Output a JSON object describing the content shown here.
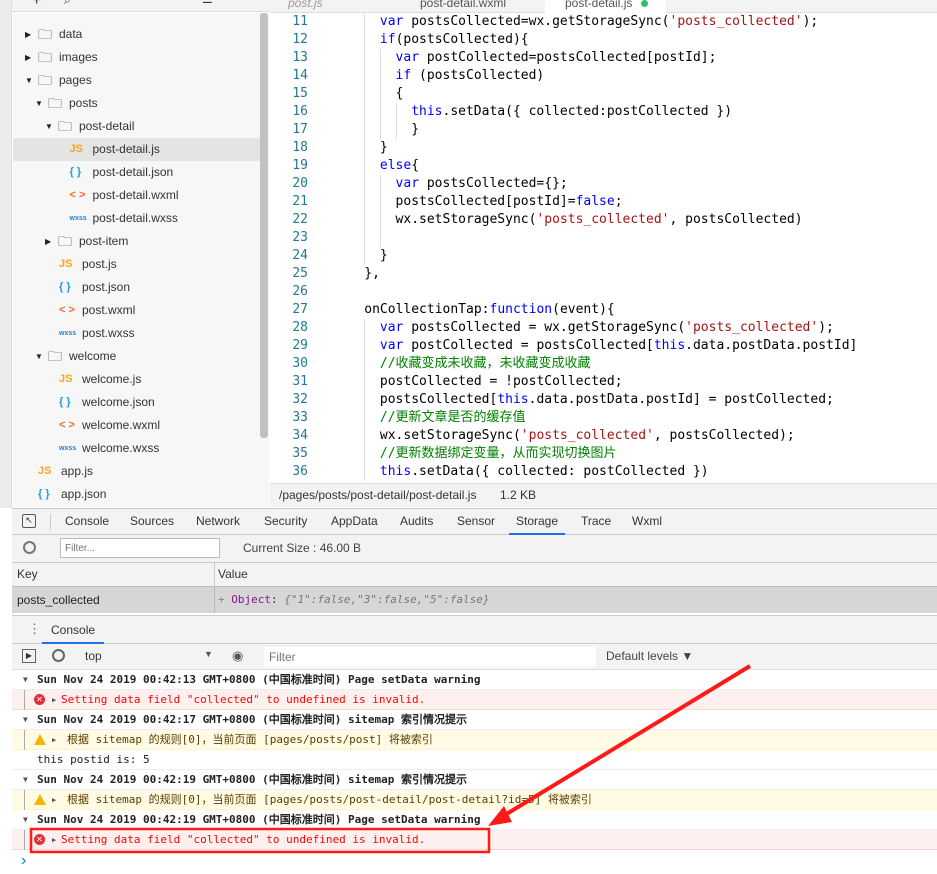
{
  "editor_tabs": [
    {
      "label": "post.js"
    },
    {
      "label": "post-detail.wxml"
    },
    {
      "label": "post-detail.js",
      "active": true,
      "modified": true
    }
  ],
  "tree": [
    {
      "kind": "folder",
      "label": "data",
      "depth": 0,
      "open": false
    },
    {
      "kind": "folder",
      "label": "images",
      "depth": 0,
      "open": false
    },
    {
      "kind": "folder",
      "label": "pages",
      "depth": 0,
      "open": true
    },
    {
      "kind": "folder",
      "label": "posts",
      "depth": 1,
      "open": true
    },
    {
      "kind": "folder",
      "label": "post-detail",
      "depth": 2,
      "open": true
    },
    {
      "kind": "js",
      "label": "post-detail.js",
      "depth": 3,
      "selected": true
    },
    {
      "kind": "json",
      "label": "post-detail.json",
      "depth": 3
    },
    {
      "kind": "wxml",
      "label": "post-detail.wxml",
      "depth": 3
    },
    {
      "kind": "wxss",
      "label": "post-detail.wxss",
      "depth": 3
    },
    {
      "kind": "folder",
      "label": "post-item",
      "depth": 2,
      "open": false
    },
    {
      "kind": "js",
      "label": "post.js",
      "depth": 2
    },
    {
      "kind": "json",
      "label": "post.json",
      "depth": 2
    },
    {
      "kind": "wxml",
      "label": "post.wxml",
      "depth": 2
    },
    {
      "kind": "wxss",
      "label": "post.wxss",
      "depth": 2
    },
    {
      "kind": "folder",
      "label": "welcome",
      "depth": 1,
      "open": true
    },
    {
      "kind": "js",
      "label": "welcome.js",
      "depth": 2
    },
    {
      "kind": "json",
      "label": "welcome.json",
      "depth": 2
    },
    {
      "kind": "wxml",
      "label": "welcome.wxml",
      "depth": 2
    },
    {
      "kind": "wxss",
      "label": "welcome.wxss",
      "depth": 2
    },
    {
      "kind": "js",
      "label": "app.js",
      "depth": 0
    },
    {
      "kind": "json",
      "label": "app.json",
      "depth": 0
    }
  ],
  "file_icons": {
    "js": {
      "glyph": "JS",
      "color": "#f5a623"
    },
    "json": {
      "glyph": "{ }",
      "color": "#1e9be6"
    },
    "wxml": {
      "glyph": "< >",
      "color": "#f06a2a"
    },
    "wxss": {
      "glyph": "wxss",
      "color": "#2a7ed0"
    }
  },
  "code": [
    {
      "n": "11",
      "indent": 6,
      "t": [
        [
          "kw",
          "var"
        ],
        [
          "pl",
          " postsCollected=wx.getStorageSync("
        ],
        [
          "str",
          "'posts_collected'"
        ],
        [
          "pl",
          ");"
        ]
      ]
    },
    {
      "n": "12",
      "indent": 6,
      "t": [
        [
          "kw",
          "if"
        ],
        [
          "pl",
          "(postsCollected){"
        ]
      ]
    },
    {
      "n": "13",
      "indent": 8,
      "t": [
        [
          "kw",
          "var"
        ],
        [
          "pl",
          " postCollected=postsCollected[postId];"
        ]
      ]
    },
    {
      "n": "14",
      "indent": 8,
      "t": [
        [
          "kw",
          "if"
        ],
        [
          "pl",
          " (postsCollected)"
        ]
      ]
    },
    {
      "n": "15",
      "indent": 8,
      "t": [
        [
          "pl",
          "{"
        ]
      ]
    },
    {
      "n": "16",
      "indent": 10,
      "t": [
        [
          "kw",
          "this"
        ],
        [
          "pl",
          ".setData({ collected:postCollected })"
        ]
      ]
    },
    {
      "n": "17",
      "indent": 10,
      "t": [
        [
          "pl",
          "}"
        ]
      ]
    },
    {
      "n": "18",
      "indent": 6,
      "t": [
        [
          "pl",
          "}"
        ]
      ]
    },
    {
      "n": "19",
      "indent": 6,
      "t": [
        [
          "kw",
          "else"
        ],
        [
          "pl",
          "{"
        ]
      ]
    },
    {
      "n": "20",
      "indent": 8,
      "t": [
        [
          "kw",
          "var"
        ],
        [
          "pl",
          " postsCollected={};"
        ]
      ]
    },
    {
      "n": "21",
      "indent": 8,
      "t": [
        [
          "pl",
          "postsCollected[postId]="
        ],
        [
          "kw",
          "false"
        ],
        [
          "pl",
          ";"
        ]
      ]
    },
    {
      "n": "22",
      "indent": 8,
      "t": [
        [
          "pl",
          "wx.setStorageSync("
        ],
        [
          "str",
          "'posts_collected'"
        ],
        [
          "pl",
          ", postsCollected)"
        ]
      ]
    },
    {
      "n": "23",
      "indent": 8,
      "t": []
    },
    {
      "n": "24",
      "indent": 6,
      "t": [
        [
          "pl",
          "}"
        ]
      ]
    },
    {
      "n": "25",
      "indent": 4,
      "t": [
        [
          "pl",
          "},"
        ]
      ]
    },
    {
      "n": "26",
      "indent": 4,
      "t": []
    },
    {
      "n": "27",
      "indent": 4,
      "t": [
        [
          "pl",
          "onCollectionTap:"
        ],
        [
          "kw",
          "function"
        ],
        [
          "pl",
          "(event){"
        ]
      ]
    },
    {
      "n": "28",
      "indent": 6,
      "t": [
        [
          "kw",
          "var"
        ],
        [
          "pl",
          " postsCollected = wx.getStorageSync("
        ],
        [
          "str",
          "'posts_collected'"
        ],
        [
          "pl",
          ");"
        ]
      ]
    },
    {
      "n": "29",
      "indent": 6,
      "t": [
        [
          "kw",
          "var"
        ],
        [
          "pl",
          " postCollected = postsCollected["
        ],
        [
          "kw",
          "this"
        ],
        [
          "pl",
          ".data.postData.postId]"
        ]
      ]
    },
    {
      "n": "30",
      "indent": 6,
      "t": [
        [
          "cm",
          "//收藏变成未收藏，未收藏变成收藏"
        ]
      ]
    },
    {
      "n": "31",
      "indent": 6,
      "t": [
        [
          "pl",
          "postCollected = !postCollected;"
        ]
      ]
    },
    {
      "n": "32",
      "indent": 6,
      "t": [
        [
          "pl",
          "postsCollected["
        ],
        [
          "kw",
          "this"
        ],
        [
          "pl",
          ".data.postData.postId] = postCollected;"
        ]
      ]
    },
    {
      "n": "33",
      "indent": 6,
      "t": [
        [
          "cm",
          "//更新文章是否的缓存值"
        ]
      ]
    },
    {
      "n": "34",
      "indent": 6,
      "t": [
        [
          "pl",
          "wx.setStorageSync("
        ],
        [
          "str",
          "'posts_collected'"
        ],
        [
          "pl",
          ", postsCollected);"
        ]
      ]
    },
    {
      "n": "35",
      "indent": 6,
      "t": [
        [
          "cm",
          "//更新数据绑定变量，从而实现切换图片"
        ]
      ]
    },
    {
      "n": "36",
      "indent": 6,
      "t": [
        [
          "kw",
          "this"
        ],
        [
          "pl",
          ".setData({ collected: postCollected })"
        ]
      ]
    }
  ],
  "status": {
    "path": "/pages/posts/post-detail/post-detail.js",
    "size": "1.2 KB"
  },
  "devtools_tabs": [
    "Console",
    "Sources",
    "Network",
    "Security",
    "AppData",
    "Audits",
    "Sensor",
    "Storage",
    "Trace",
    "Wxml"
  ],
  "devtools_active": "Storage",
  "storage": {
    "filter_placeholder": "Filter...",
    "current_size": "Current Size : 46.00 B",
    "col_key": "Key",
    "col_value": "Value",
    "rows": [
      {
        "key": "posts_collected",
        "prefix": "+ ",
        "type": "Object",
        "sep": ": ",
        "value": "{\"1\":false,\"3\":false,\"5\":false}"
      }
    ]
  },
  "drawer_tab": "Console",
  "console_toolbar": {
    "context": "top",
    "filter_placeholder": "Filter",
    "levels": "Default levels ▼"
  },
  "logs": [
    {
      "kind": "head",
      "text": "Sun Nov 24 2019 00:42:13 GMT+0800 (中国标准时间) Page setData warning"
    },
    {
      "kind": "err",
      "text": "Setting data field \"collected\" to undefined is invalid."
    },
    {
      "kind": "head",
      "text": "Sun Nov 24 2019 00:42:17 GMT+0800 (中国标准时间) sitemap 索引情况提示"
    },
    {
      "kind": "warn",
      "text": "根据 sitemap 的规则[0]，当前页面 [pages/posts/post] 将被索引"
    },
    {
      "kind": "plain",
      "text": "this postid is: 5"
    },
    {
      "kind": "head",
      "text": "Sun Nov 24 2019 00:42:19 GMT+0800 (中国标准时间) sitemap 索引情况提示"
    },
    {
      "kind": "warn",
      "text": "根据 sitemap 的规则[0]，当前页面 [pages/posts/post-detail/post-detail?id=5] 将被索引"
    },
    {
      "kind": "head",
      "text": "Sun Nov 24 2019 00:42:19 GMT+0800 (中国标准时间) Page setData warning"
    },
    {
      "kind": "err",
      "text": "Setting data field \"collected\" to undefined is invalid.",
      "highlighted": true
    }
  ],
  "colors": {
    "accent": "#1a73e8",
    "error": "#ff0000",
    "annotation": "#ff1a1a"
  }
}
